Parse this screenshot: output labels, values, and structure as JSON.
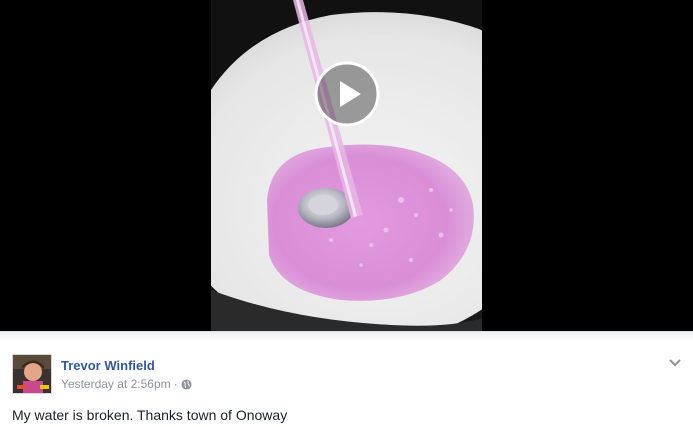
{
  "video": {
    "play_icon": "play-icon"
  },
  "post": {
    "author": "Trevor Winfield",
    "timestamp": "Yesterday at 2:56pm",
    "separator": "·",
    "privacy_icon": "globe-icon",
    "menu_icon": "chevron-down-icon",
    "text": "My water is broken. Thanks town of Onoway"
  },
  "colors": {
    "link_blue": "#365899",
    "meta_gray": "#90949c",
    "text_dark": "#1d2129"
  }
}
